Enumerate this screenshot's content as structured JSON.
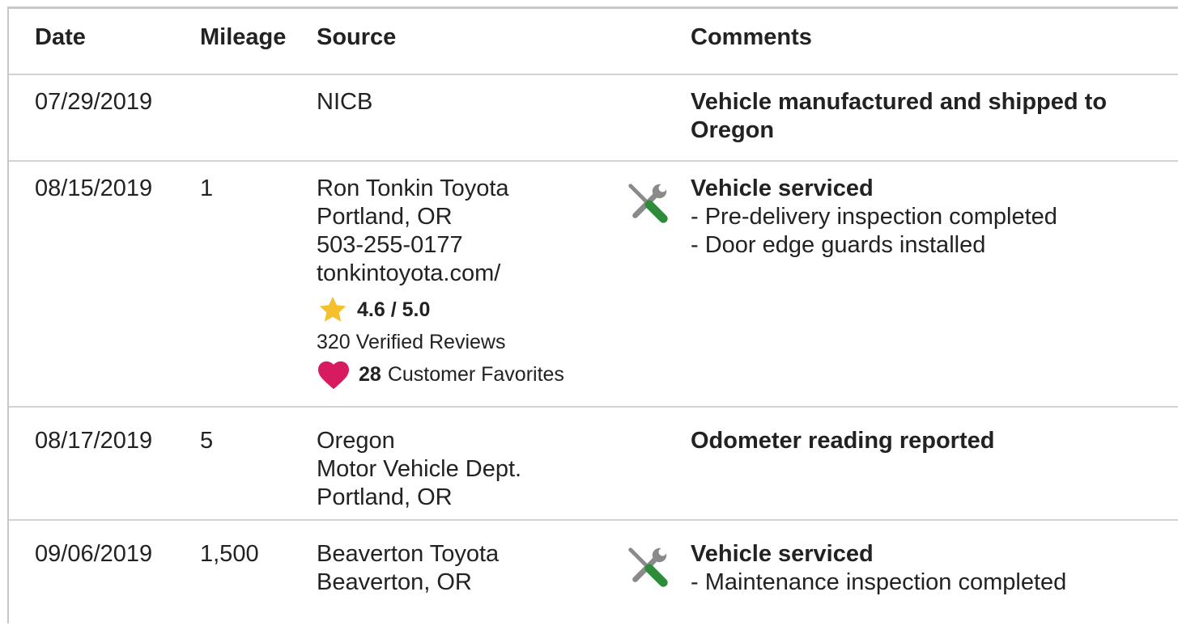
{
  "headers": {
    "date": "Date",
    "mileage": "Mileage",
    "source": "Source",
    "comments": "Comments"
  },
  "rows": [
    {
      "date": "07/29/2019",
      "mileage": "",
      "source": [
        "NICB"
      ],
      "comment_title": "Vehicle manufactured and shipped to Oregon",
      "comment_items": [],
      "icon": ""
    },
    {
      "date": "08/15/2019",
      "mileage": "1",
      "source": [
        "Ron Tonkin Toyota",
        "Portland, OR",
        "503-255-0177",
        "tonkintoyota.com/"
      ],
      "rating": "4.6 / 5.0",
      "reviews": "320 Verified Reviews",
      "favorites_count": "28",
      "favorites_label": "Customer Favorites",
      "comment_title": "Vehicle serviced",
      "comment_items": [
        "Pre-delivery inspection completed",
        "Door edge guards installed"
      ],
      "icon": "wrench-screwdriver-icon"
    },
    {
      "date": "08/17/2019",
      "mileage": "5",
      "source": [
        "Oregon",
        "Motor Vehicle Dept.",
        "Portland, OR"
      ],
      "comment_title": "Odometer reading reported",
      "comment_items": [],
      "icon": ""
    },
    {
      "date": "09/06/2019",
      "mileage": "1,500",
      "source": [
        "Beaverton Toyota",
        "Beaverton, OR"
      ],
      "comment_title": "Vehicle serviced",
      "comment_items": [
        "Maintenance inspection completed"
      ],
      "icon": "wrench-screwdriver-icon"
    }
  ],
  "colors": {
    "star": "#f5c02c",
    "heart": "#d81b60",
    "tool_gray": "#8a8a8a",
    "tool_green": "#2e8b3a",
    "border": "#d2d2d2"
  }
}
